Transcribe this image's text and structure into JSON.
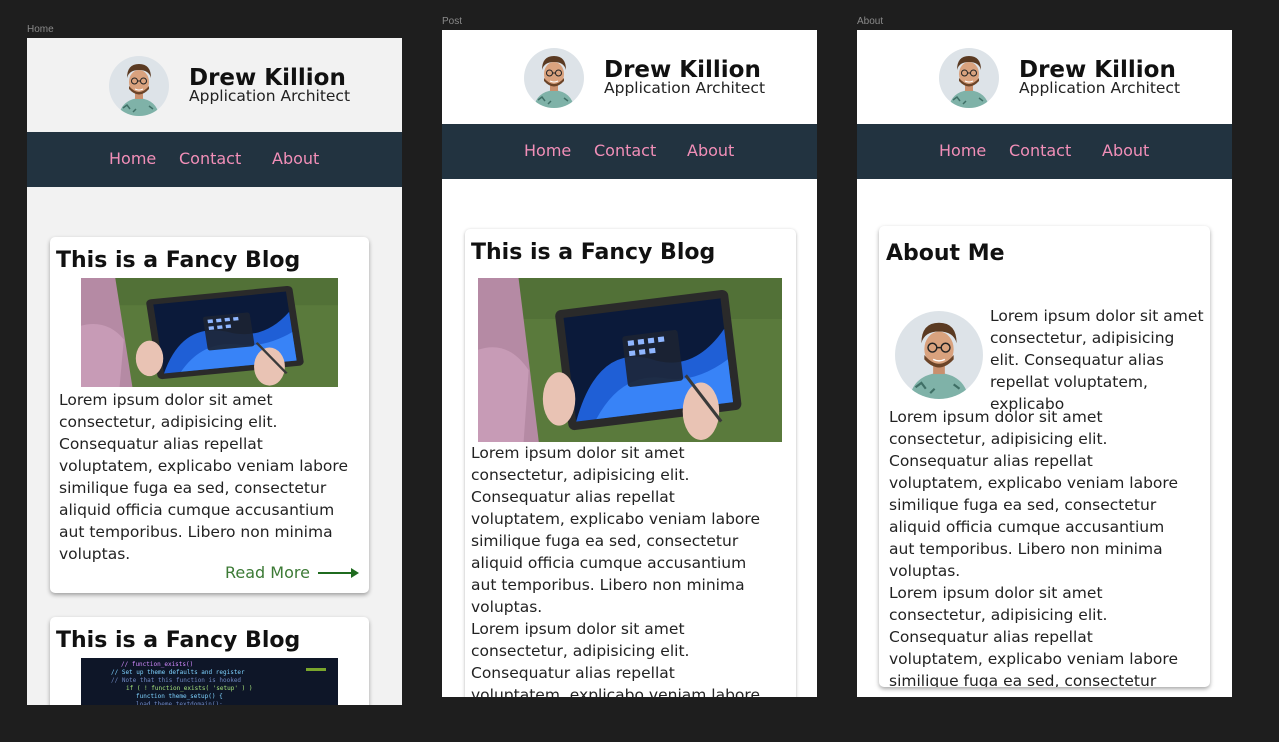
{
  "frames": {
    "home": {
      "label": "Home"
    },
    "post": {
      "label": "Post"
    },
    "about": {
      "label": "About"
    }
  },
  "profile": {
    "name": "Drew Killion",
    "role": "Application Architect"
  },
  "nav": {
    "home": "Home",
    "contact": "Contact",
    "about": "About"
  },
  "blog": {
    "title": "This is a Fancy Blog",
    "excerpt": "Lorem ipsum dolor sit amet consectetur, adipisicing elit. Consequatur alias repellat voluptatem, explicabo veniam labore similique fuga ea sed, consectetur aliquid officia cumque accusantium aut temporibus. Libero non minima voluptas.",
    "read_more": "Read More",
    "second_title": "This is a Fancy Blog"
  },
  "post": {
    "title": "This is a Fancy Blog",
    "paragraphs": [
      "Lorem ipsum dolor sit amet consectetur, adipisicing elit. Consequatur alias repellat voluptatem, explicabo veniam labore similique fuga ea sed, consectetur aliquid officia cumque accusantium aut temporibus. Libero non minima voluptas.",
      "Lorem ipsum dolor sit amet consectetur, adipisicing elit. Consequatur alias repellat voluptatem, explicabo veniam labore similique fuga ea sed, consectetur aliquid officia"
    ]
  },
  "about": {
    "title": "About Me",
    "intro": "Lorem ipsum dolor sit amet consectetur, adipisicing elit. Consequatur alias repellat voluptatem, explicabo",
    "paragraphs": [
      "Lorem ipsum dolor sit amet consectetur, adipisicing elit. Consequatur alias repellat voluptatem, explicabo veniam labore similique fuga ea sed, consectetur aliquid officia cumque accusantium aut temporibus. Libero non minima voluptas.",
      "Lorem ipsum dolor sit amet consectetur, adipisicing elit. Consequatur alias repellat voluptatem, explicabo veniam labore similique fuga ea sed, consectetur aliquid officia cumque accusantium aut temporibus."
    ]
  },
  "colors": {
    "canvas": "#1e1e1e",
    "nav_bg": "#223340",
    "nav_link": "#f28fb8",
    "read_more": "#3c7a35",
    "home_bg": "#f2f2f2",
    "page_bg": "#ffffff"
  },
  "icons": {
    "avatar": "avatar-photo",
    "blog_image": "tablet-photo",
    "code_image": "code-photo",
    "read_more": "arrow-right-icon"
  }
}
